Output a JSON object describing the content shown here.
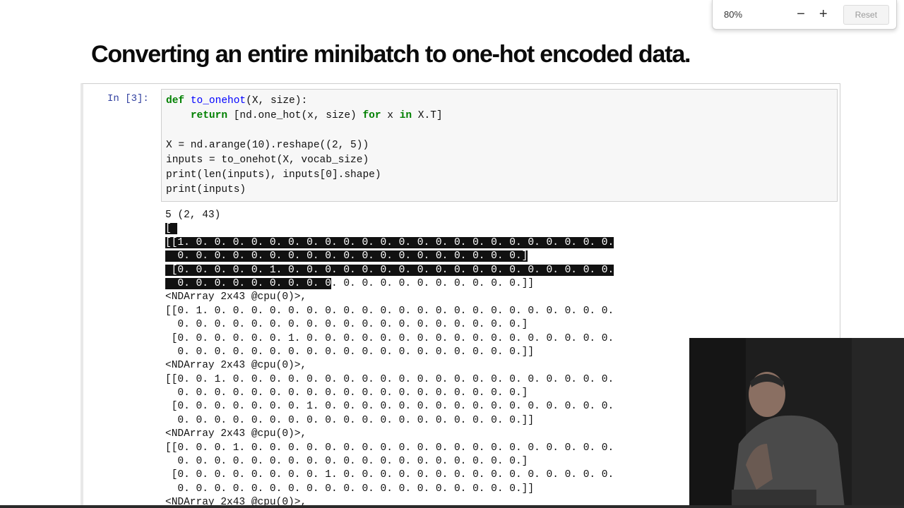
{
  "zoom": {
    "level": "80%",
    "minus": "−",
    "plus": "+",
    "reset": "Reset"
  },
  "title": "Converting an entire minibatch to one-hot encoded data.",
  "cell": {
    "prompt": "In [3]:",
    "code": [
      "def to_onehot(X, size):",
      "    return [nd.one_hot(x, size) for x in X.T]",
      "",
      "X = nd.arange(10).reshape((2, 5))",
      "inputs = to_onehot(X, vocab_size)",
      "print(len(inputs), inputs[0].shape)",
      "print(inputs)"
    ],
    "output": {
      "first_line": "5 (2, 43)",
      "open_bracket": "[",
      "selected_block": [
        "[[1. 0. 0. 0. 0. 0. 0. 0. 0. 0. 0. 0. 0. 0. 0. 0. 0. 0. 0. 0. 0. 0. 0. 0.",
        "  0. 0. 0. 0. 0. 0. 0. 0. 0. 0. 0. 0. 0. 0. 0. 0. 0. 0. 0.]",
        " [0. 0. 0. 0. 0. 1. 0. 0. 0. 0. 0. 0. 0. 0. 0. 0. 0. 0. 0. 0. 0. 0. 0. 0.",
        "  0. 0. 0. 0. 0. 0. 0. 0. 0"
      ],
      "selected_tail": ". 0. 0. 0. 0. 0. 0. 0. 0. 0. 0.]]",
      "lines": [
        "<NDArray 2x43 @cpu(0)>,",
        "[[0. 1. 0. 0. 0. 0. 0. 0. 0. 0. 0. 0. 0. 0. 0. 0. 0. 0. 0. 0. 0. 0. 0. 0.",
        "  0. 0. 0. 0. 0. 0. 0. 0. 0. 0. 0. 0. 0. 0. 0. 0. 0. 0. 0.]",
        " [0. 0. 0. 0. 0. 0. 1. 0. 0. 0. 0. 0. 0. 0. 0. 0. 0. 0. 0. 0. 0. 0. 0. 0.",
        "  0. 0. 0. 0. 0. 0. 0. 0. 0. 0. 0. 0. 0. 0. 0. 0. 0. 0. 0.]]",
        "<NDArray 2x43 @cpu(0)>,",
        "[[0. 0. 1. 0. 0. 0. 0. 0. 0. 0. 0. 0. 0. 0. 0. 0. 0. 0. 0. 0. 0. 0. 0. 0.",
        "  0. 0. 0. 0. 0. 0. 0. 0. 0. 0. 0. 0. 0. 0. 0. 0. 0. 0. 0.]",
        " [0. 0. 0. 0. 0. 0. 0. 1. 0. 0. 0. 0. 0. 0. 0. 0. 0. 0. 0. 0. 0. 0. 0. 0.",
        "  0. 0. 0. 0. 0. 0. 0. 0. 0. 0. 0. 0. 0. 0. 0. 0. 0. 0. 0.]]",
        "<NDArray 2x43 @cpu(0)>,",
        "[[0. 0. 0. 1. 0. 0. 0. 0. 0. 0. 0. 0. 0. 0. 0. 0. 0. 0. 0. 0. 0. 0. 0. 0.",
        "  0. 0. 0. 0. 0. 0. 0. 0. 0. 0. 0. 0. 0. 0. 0. 0. 0. 0. 0.]",
        " [0. 0. 0. 0. 0. 0. 0. 0. 1. 0. 0. 0. 0. 0. 0. 0. 0. 0. 0. 0. 0. 0. 0. 0.",
        "  0. 0. 0. 0. 0. 0. 0. 0. 0. 0. 0. 0. 0. 0. 0. 0. 0. 0. 0.]]",
        "<NDArray 2x43 @cpu(0)>,"
      ]
    }
  },
  "webcam": {
    "icon": "webcam-presenter-icon"
  }
}
